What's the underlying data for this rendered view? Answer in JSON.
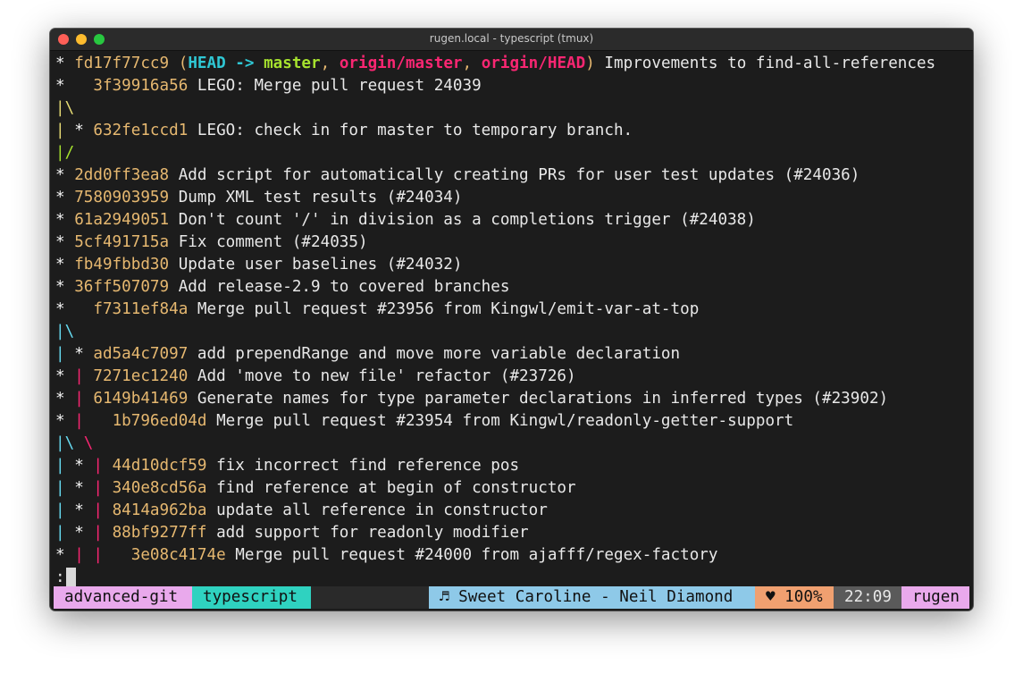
{
  "window": {
    "title": "rugen.local - typescript (tmux)"
  },
  "log": [
    [
      {
        "t": "* ",
        "c": "c-star"
      },
      {
        "t": "fd17f77cc9",
        "c": "c-hash"
      },
      {
        "t": " (",
        "c": "c-par"
      },
      {
        "t": "HEAD -> ",
        "c": "c-head"
      },
      {
        "t": "master",
        "c": "c-br"
      },
      {
        "t": ", ",
        "c": "c-par"
      },
      {
        "t": "origin/master",
        "c": "c-or"
      },
      {
        "t": ", ",
        "c": "c-par"
      },
      {
        "t": "origin/HEAD",
        "c": "c-or"
      },
      {
        "t": ")",
        "c": "c-par"
      },
      {
        "t": " Improvements to find-all-references",
        "c": "c-w"
      }
    ],
    [
      {
        "t": "*   ",
        "c": "c-star"
      },
      {
        "t": "3f39916a56",
        "c": "c-hash"
      },
      {
        "t": " LEGO: Merge pull request 24039",
        "c": "c-w"
      }
    ],
    [
      {
        "t": "|\\",
        "c": "c-y"
      }
    ],
    [
      {
        "t": "| ",
        "c": "c-y"
      },
      {
        "t": "* ",
        "c": "c-star"
      },
      {
        "t": "632fe1ccd1",
        "c": "c-hash"
      },
      {
        "t": " LEGO: check in for master to temporary branch.",
        "c": "c-w"
      }
    ],
    [
      {
        "t": "|/",
        "c": "c-g"
      }
    ],
    [
      {
        "t": "* ",
        "c": "c-star"
      },
      {
        "t": "2dd0ff3ea8",
        "c": "c-hash"
      },
      {
        "t": " Add script for automatically creating PRs for user test updates (#24036)",
        "c": "c-w"
      }
    ],
    [
      {
        "t": "* ",
        "c": "c-star"
      },
      {
        "t": "7580903959",
        "c": "c-hash"
      },
      {
        "t": " Dump XML test results (#24034)",
        "c": "c-w"
      }
    ],
    [
      {
        "t": "* ",
        "c": "c-star"
      },
      {
        "t": "61a2949051",
        "c": "c-hash"
      },
      {
        "t": " Don't count '/' in division as a completions trigger (#24038)",
        "c": "c-w"
      }
    ],
    [
      {
        "t": "* ",
        "c": "c-star"
      },
      {
        "t": "5cf491715a",
        "c": "c-hash"
      },
      {
        "t": " Fix comment (#24035)",
        "c": "c-w"
      }
    ],
    [
      {
        "t": "* ",
        "c": "c-star"
      },
      {
        "t": "fb49fbbd30",
        "c": "c-hash"
      },
      {
        "t": " Update user baselines (#24032)",
        "c": "c-w"
      }
    ],
    [
      {
        "t": "* ",
        "c": "c-star"
      },
      {
        "t": "36ff507079",
        "c": "c-hash"
      },
      {
        "t": " Add release-2.9 to covered branches",
        "c": "c-w"
      }
    ],
    [
      {
        "t": "*   ",
        "c": "c-star"
      },
      {
        "t": "f7311ef84a",
        "c": "c-hash"
      },
      {
        "t": " Merge pull request #23956 from Kingwl/emit-var-at-top",
        "c": "c-w"
      }
    ],
    [
      {
        "t": "|\\",
        "c": "c-b"
      }
    ],
    [
      {
        "t": "| ",
        "c": "c-b"
      },
      {
        "t": "* ",
        "c": "c-star"
      },
      {
        "t": "ad5a4c7097",
        "c": "c-hash"
      },
      {
        "t": " add prependRange and move more variable declaration",
        "c": "c-w"
      }
    ],
    [
      {
        "t": "* ",
        "c": "c-star"
      },
      {
        "t": "| ",
        "c": "c-p"
      },
      {
        "t": "7271ec1240",
        "c": "c-hash"
      },
      {
        "t": " Add 'move to new file' refactor (#23726)",
        "c": "c-w"
      }
    ],
    [
      {
        "t": "* ",
        "c": "c-star"
      },
      {
        "t": "| ",
        "c": "c-p"
      },
      {
        "t": "6149b41469",
        "c": "c-hash"
      },
      {
        "t": " Generate names for type parameter declarations in inferred types (#23902)",
        "c": "c-w"
      }
    ],
    [
      {
        "t": "* ",
        "c": "c-star"
      },
      {
        "t": "|   ",
        "c": "c-p"
      },
      {
        "t": "1b796ed04d",
        "c": "c-hash"
      },
      {
        "t": " Merge pull request #23954 from Kingwl/readonly-getter-support",
        "c": "c-w"
      }
    ],
    [
      {
        "t": "|\\ ",
        "c": "c-b"
      },
      {
        "t": "\\",
        "c": "c-p"
      }
    ],
    [
      {
        "t": "| ",
        "c": "c-b"
      },
      {
        "t": "* ",
        "c": "c-star"
      },
      {
        "t": "| ",
        "c": "c-p"
      },
      {
        "t": "44d10dcf59",
        "c": "c-hash"
      },
      {
        "t": " fix incorrect find reference pos",
        "c": "c-w"
      }
    ],
    [
      {
        "t": "| ",
        "c": "c-b"
      },
      {
        "t": "* ",
        "c": "c-star"
      },
      {
        "t": "| ",
        "c": "c-p"
      },
      {
        "t": "340e8cd56a",
        "c": "c-hash"
      },
      {
        "t": " find reference at begin of constructor",
        "c": "c-w"
      }
    ],
    [
      {
        "t": "| ",
        "c": "c-b"
      },
      {
        "t": "* ",
        "c": "c-star"
      },
      {
        "t": "| ",
        "c": "c-p"
      },
      {
        "t": "8414a962ba",
        "c": "c-hash"
      },
      {
        "t": " update all reference in constructor",
        "c": "c-w"
      }
    ],
    [
      {
        "t": "| ",
        "c": "c-b"
      },
      {
        "t": "* ",
        "c": "c-star"
      },
      {
        "t": "| ",
        "c": "c-p"
      },
      {
        "t": "88bf9277ff",
        "c": "c-hash"
      },
      {
        "t": " add support for readonly modifier",
        "c": "c-w"
      }
    ],
    [
      {
        "t": "* ",
        "c": "c-star"
      },
      {
        "t": "| ",
        "c": "c-p"
      },
      {
        "t": "|   ",
        "c": "c-p"
      },
      {
        "t": "3e08c4174e",
        "c": "c-hash"
      },
      {
        "t": " Merge pull request #24000 from ajafff/regex-factory",
        "c": "c-w"
      }
    ]
  ],
  "prompt": ":",
  "status": {
    "session": "advanced-git",
    "window": "typescript",
    "music": "♬ Sweet Caroline - Neil Diamond",
    "battery": "♥ 100%",
    "clock": "22:09",
    "host": "rugen"
  },
  "colors": {
    "session": "#e9a9ec",
    "window": "#2fd2c0",
    "music": "#8ec9e8",
    "battery": "#f0a070",
    "clock": "#5a5a5a",
    "host": "#e9a9ec",
    "hash": "#e6b870",
    "head": "#2fc7d4",
    "branch": "#a6e22e",
    "origin": "#f92672"
  }
}
